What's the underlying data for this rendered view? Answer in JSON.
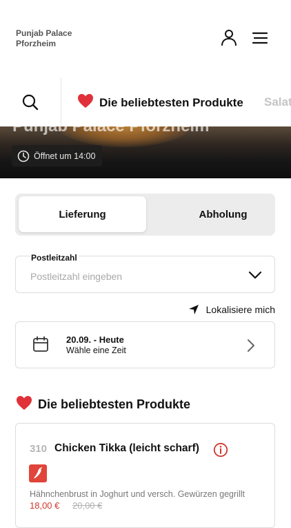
{
  "header": {
    "brand_line1": "Punjab Palace",
    "brand_line2": "Pforzheim",
    "icons": [
      "user-icon",
      "menu-icon"
    ]
  },
  "categories": {
    "active": "Die beliebtesten Produkte",
    "next": "Salat"
  },
  "hero": {
    "title": "Punjab Palace Pforzheim",
    "open_badge": "Öffnet um 14:00"
  },
  "order_mode": {
    "options": [
      "Lieferung",
      "Abholung"
    ],
    "selected": "Lieferung"
  },
  "zip": {
    "label": "Postleitzahl",
    "placeholder": "Postleitzahl eingeben"
  },
  "locate_label": "Lokalisiere mich",
  "date": {
    "main": "20.09. - Heute",
    "sub": "Wähle eine Zeit"
  },
  "section_title": "Die beliebtesten Produkte",
  "product": {
    "number": "310",
    "name": "Chicken Tikka (leicht scharf)",
    "description": "Hähnchenbrust in Joghurt und versch. Gewürzen gegrillt",
    "price": "18,00 €",
    "old_price": "20,00 €"
  },
  "colors": {
    "accent_red": "#d0372b",
    "chili_bg": "#e0443a",
    "heart": "#e0313a"
  }
}
